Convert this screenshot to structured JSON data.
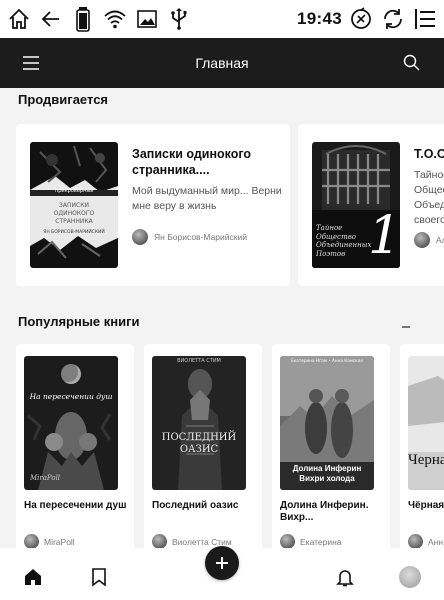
{
  "status": {
    "time": "19:43"
  },
  "header": {
    "title": "Главная"
  },
  "promoted": {
    "title": "Продвигается",
    "cards": [
      {
        "title": "Записки одинокого странника....",
        "description": "Мой выдуманный мир... Верни мне веру в жизнь",
        "author": "Ян Борисов-Марийский",
        "cover_title": "Записки одинокого странника",
        "cover_author": "Ян Борисов-Марийский",
        "cover_series": "Прикроверный"
      },
      {
        "title": "Т.О.О.П.",
        "description": "Тайное Общество Объединенных своего, стихах",
        "author": "Ал",
        "cover_text": "Тайное Общество Объединенных Поэтов",
        "cover_number": "1"
      }
    ]
  },
  "popular": {
    "title": "Популярные книги",
    "books": [
      {
        "title": "На пересечении душ",
        "author": "MiraPoll",
        "cover_text": "На пересечении душ",
        "cover_author": "MiraPoll"
      },
      {
        "title": "Последний оазис",
        "author": "Виолетта Стим",
        "cover_text": "ПОСЛЕДНИЙ ОАЗИС",
        "cover_author": "ВИОЛЕТТА СТИМ"
      },
      {
        "title": "Долина Инферин. Вихр...",
        "author": "Екатерина",
        "cover_text": "Долина Инферин Вихри холода",
        "cover_author": "Екатерина Нгам • Анна Камская"
      },
      {
        "title": "Чёрная",
        "author": "Анн",
        "cover_text": "Черна"
      }
    ]
  },
  "nav": {
    "items": [
      "home-icon",
      "bookmark-icon",
      "add-icon",
      "bell-icon",
      "profile-avatar"
    ]
  }
}
